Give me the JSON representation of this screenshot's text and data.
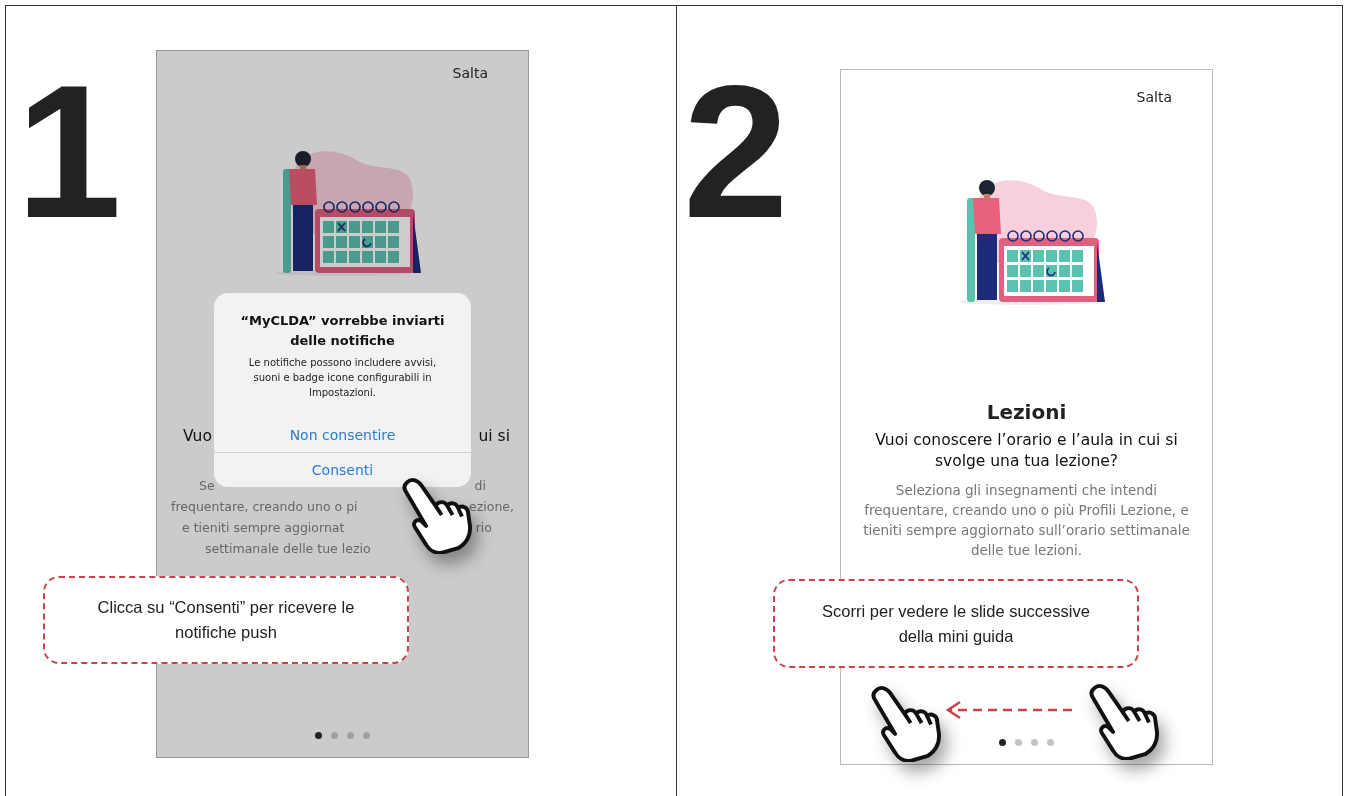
{
  "panels": [
    {
      "step": "1",
      "kind": "dialog",
      "phone": {
        "skip": "Salta",
        "fragment_rows": [
          {
            "kind": "heading",
            "left": "Vuo",
            "right": "ui si"
          },
          {
            "kind": "body",
            "left": "Se",
            "right": "di"
          },
          {
            "kind": "body",
            "left": "frequentare, creando uno o pi",
            "right": "ezione,"
          },
          {
            "kind": "body",
            "left": "e tieniti sempre aggiornat",
            "right": "rio"
          },
          {
            "kind": "body",
            "left": "settimanale delle tue lezio"
          }
        ],
        "dialog": {
          "title": "“MyCLDA” vorrebbe inviarti delle notifiche",
          "message": "Le notifiche possono includere avvisi, suoni e badge icone configurabili in Impostazioni.",
          "buttons": [
            "Non consentire",
            "Consenti"
          ]
        },
        "dots": [
          {
            "selected": true
          },
          {
            "selected": false
          },
          {
            "selected": false
          },
          {
            "selected": false
          }
        ]
      },
      "callout": "Clicca su “Consenti” per ricevere le notifiche push"
    },
    {
      "step": "2",
      "kind": "plain",
      "phone": {
        "skip": "Salta",
        "title": "Lezioni",
        "subtitle": "Vuoi conoscere l’orario e l’aula in cui si svolge una tua lezione?",
        "body": "Seleziona gli insegnamenti che intendi frequentare, creando uno o più Profili Lezione, e tieniti sempre aggiornato sull’orario settimanale delle tue lezioni.",
        "dots": [
          {
            "selected": true
          },
          {
            "selected": false
          },
          {
            "selected": false
          },
          {
            "selected": false
          }
        ]
      },
      "callout": "Scorri per vedere le slide successive della mini guida"
    }
  ]
}
